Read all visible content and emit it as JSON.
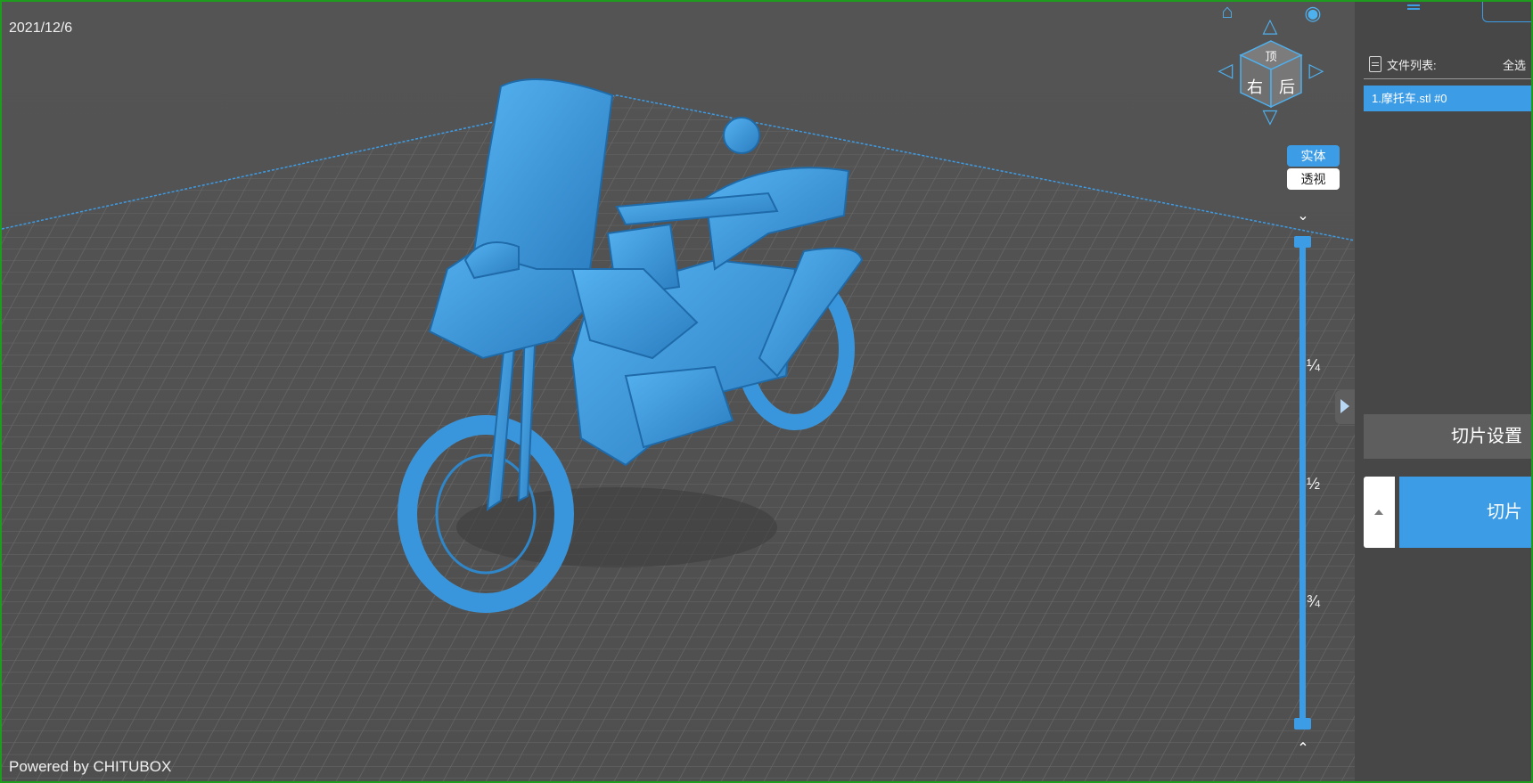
{
  "viewport": {
    "date": "2021/12/6",
    "powered_by": "Powered by CHITUBOX"
  },
  "view_cube": {
    "face_top": "顶",
    "face_right": "右",
    "face_back": "后"
  },
  "view_mode": {
    "solid": "实体",
    "perspective": "透视",
    "active": "solid"
  },
  "layer_slider": {
    "quarter": "¼",
    "half": "½",
    "three_quarters": "¾"
  },
  "file_list": {
    "title": "文件列表:",
    "select_all": "全选",
    "files": [
      {
        "label": "1.摩托车.stl #0",
        "selected": true
      }
    ]
  },
  "actions": {
    "slice_settings": "切片设置",
    "slice": "切片"
  },
  "colors": {
    "accent": "#3d9ce6",
    "model": "#3a96dc",
    "background": "#4e4e4e"
  }
}
